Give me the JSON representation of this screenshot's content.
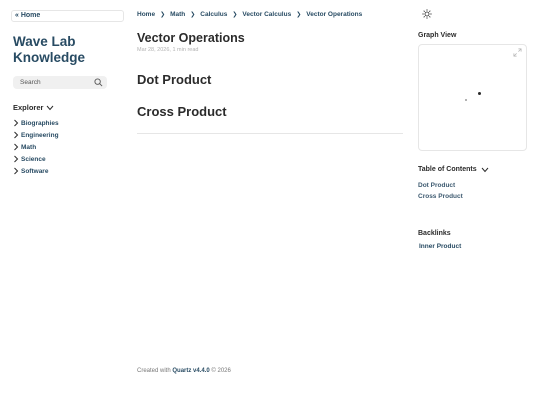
{
  "sidebar": {
    "home_link": "« Home",
    "site_title": "Wave Lab Knowledge",
    "search_placeholder": "Search",
    "explorer_title": "Explorer",
    "tree": [
      {
        "label": "Biographies"
      },
      {
        "label": "Engineering"
      },
      {
        "label": "Math"
      },
      {
        "label": "Science"
      },
      {
        "label": "Software"
      }
    ]
  },
  "breadcrumb": {
    "items": [
      "Home",
      "Math",
      "Calculus",
      "Vector Calculus",
      "Vector Operations"
    ],
    "separator": "❯"
  },
  "page": {
    "title": "Vector Operations",
    "meta": "Mar 28, 2026, 1 min read",
    "headings": [
      "Dot Product",
      "Cross Product"
    ]
  },
  "footer": {
    "prefix": "Created with",
    "brand": "Quartz v4.4.0",
    "suffix": "© 2026"
  },
  "right": {
    "graph_title": "Graph View",
    "toc_title": "Table of Contents",
    "toc": [
      "Dot Product",
      "Cross Product"
    ],
    "backlinks_title": "Backlinks",
    "backlinks": [
      "Inner Product"
    ]
  },
  "icons": {
    "theme": "sun-icon",
    "search": "search-icon",
    "graph_expand": "expand-icon"
  },
  "colors": {
    "accent": "#284b63",
    "text": "#2b2b2b",
    "muted": "#b2b2b2",
    "border": "#e6e6e6"
  }
}
